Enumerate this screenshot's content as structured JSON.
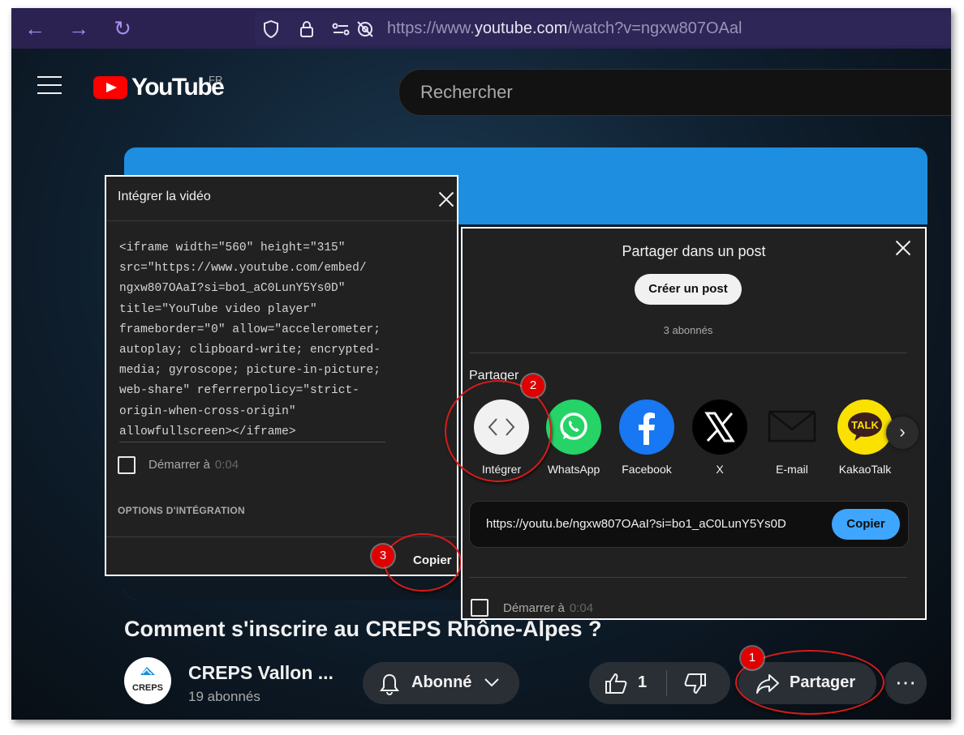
{
  "browser": {
    "url_prefix": "https://www.",
    "url_host": "youtube.com",
    "url_path": "/watch?v=ngxw807OAal"
  },
  "header": {
    "logo_text": "YouTube",
    "country_code": "FR",
    "search_placeholder": "Rechercher"
  },
  "embed_dialog": {
    "title": "Intégrer la vidéo",
    "code_lines": [
      "<iframe width=\"560\" height=\"315\"",
      "src=\"https://www.youtube.com/embed/",
      "ngxw807OAaI?si=bo1_aC0LunY5Ys0D\"",
      "title=\"YouTube video player\"",
      "frameborder=\"0\" allow=\"accelerometer;",
      "autoplay; clipboard-write; encrypted-",
      "media; gyroscope; picture-in-picture;",
      "web-share\" referrerpolicy=\"strict-",
      "origin-when-cross-origin\"",
      "allowfullscreen></iframe>"
    ],
    "start_label": "Démarrer à",
    "start_time": "0:04",
    "options_heading": "OPTIONS D'INTÉGRATION",
    "copy_label": "Copier"
  },
  "share_dialog": {
    "title": "Partager dans un post",
    "create_post_label": "Créer un post",
    "subscribers": "3 abonnés",
    "share_heading": "Partager",
    "targets": [
      {
        "label": "Intégrer",
        "icon": "embed-code-icon",
        "color": "#f1f1f1"
      },
      {
        "label": "WhatsApp",
        "icon": "whatsapp-icon",
        "color": "#25d366"
      },
      {
        "label": "Facebook",
        "icon": "facebook-icon",
        "color": "#1877f2"
      },
      {
        "label": "X",
        "icon": "x-icon",
        "color": "#000000"
      },
      {
        "label": "E-mail",
        "icon": "email-icon",
        "color": "#212121"
      },
      {
        "label": "KakaoTalk",
        "icon": "kakaotalk-icon",
        "color": "#fae100"
      }
    ],
    "link": "https://youtu.be/ngxw807OAaI?si=bo1_aC0LunY5Ys0D",
    "copy_label": "Copier",
    "start_label": "Démarrer à",
    "start_time": "0:04"
  },
  "video": {
    "title": "Comment s'inscrire au CREPS Rhône-Alpes ?",
    "channel_name": "CREPS Vallon ...",
    "channel_subs": "19 abonnés",
    "avatar_text": "CREPS",
    "subscribe_label": "Abonné",
    "like_count": "1",
    "share_label": "Partager",
    "more_label": "⋯"
  },
  "annotations": {
    "badge1": "1",
    "badge2": "2",
    "badge3": "3"
  },
  "colors": {
    "accent_blue": "#3ea6ff",
    "annotation_red": "#e00000",
    "browser_bar": "#2b2252"
  }
}
